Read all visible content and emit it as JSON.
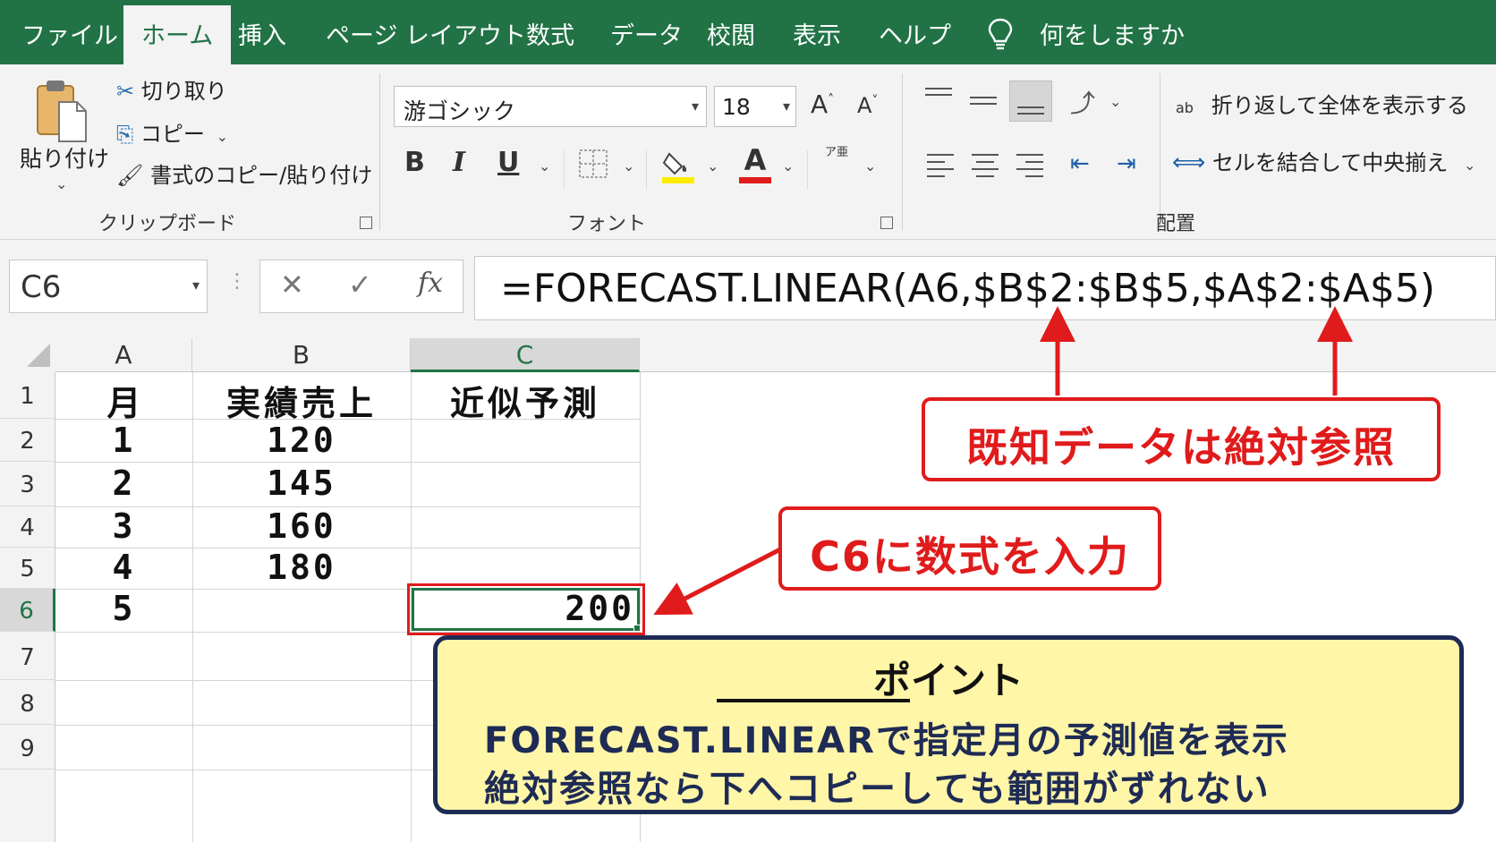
{
  "menu": {
    "tabs": [
      "ファイル",
      "ホーム",
      "挿入",
      "ページ レイアウト",
      "数式",
      "データ",
      "校閲",
      "表示",
      "ヘルプ"
    ],
    "active_tab": "ホーム",
    "tell_me": "何をしますか"
  },
  "ribbon": {
    "clipboard": {
      "paste": "貼り付け",
      "cut": "切り取り",
      "copy": "コピー",
      "format_painter": "書式のコピー/貼り付け",
      "group_label": "クリップボード"
    },
    "font": {
      "font_name": "游ゴシック",
      "font_size": "18",
      "grow": "A",
      "shrink": "A",
      "bold": "B",
      "italic": "I",
      "underline": "U",
      "font_color_letter": "A",
      "phonetic": "ア亜",
      "group_label": "フォント",
      "highlight_color": "#ffeb00",
      "font_color": "#e01b1b"
    },
    "alignment": {
      "wrap_text": "折り返して全体を表示する",
      "merge_center": "セルを結合して中央揃え",
      "group_label": "配置",
      "wrap_icon_text": "ab"
    }
  },
  "formula_bar": {
    "name_box": "C6",
    "fx": "fx",
    "formula": "=FORECAST.LINEAR(A6,$B$2:$B$5,$A$2:$A$5)"
  },
  "sheet": {
    "columns": [
      "A",
      "B",
      "C"
    ],
    "rows": [
      "1",
      "2",
      "3",
      "4",
      "5",
      "6",
      "7",
      "8",
      "9"
    ],
    "headers": {
      "a": "月",
      "b": "実績売上",
      "c": "近似予測"
    },
    "data": [
      {
        "a": "1",
        "b": "120",
        "c": ""
      },
      {
        "a": "2",
        "b": "145",
        "c": ""
      },
      {
        "a": "3",
        "b": "160",
        "c": ""
      },
      {
        "a": "4",
        "b": "180",
        "c": ""
      },
      {
        "a": "5",
        "b": "",
        "c": "200"
      }
    ],
    "selected_cell": "C6"
  },
  "annotations": {
    "absolute_ref": "既知データは絶対参照",
    "enter_formula": "C6に数式を入力",
    "point_title": "ポイント",
    "point_line1": "FORECAST.LINEARで指定月の予測値を表示",
    "point_line2": "絶対参照なら下へコピーしても範囲がずれない",
    "accent_color": "#e01b1b",
    "point_bg": "#fff6a8"
  }
}
